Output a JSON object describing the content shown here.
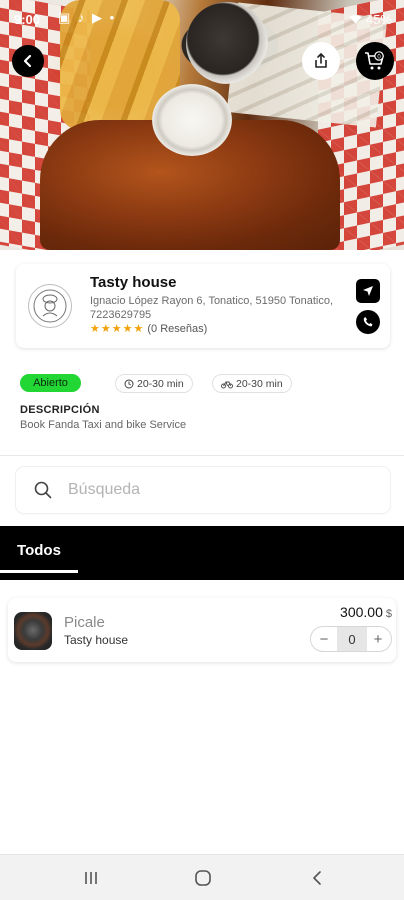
{
  "statusbar": {
    "time": "9:00",
    "icons": "▣ ♪ ▶ •",
    "battery": "45%"
  },
  "hero": {
    "image_desc": "food-photo"
  },
  "restaurant": {
    "name": "Tasty house",
    "address": "Ignacio López Rayon 6, Tonatico, 51950 Tonatico,",
    "phone": "7223629795",
    "stars": "★★★★★",
    "reviews": "(0 Reseñas)"
  },
  "info": {
    "status": "Abierto",
    "delivery_time_1": "20-30 min",
    "delivery_time_2": "20-30 min",
    "description_title": "DESCRIPCIÓN",
    "description_text": "Book Fanda Taxi and bike Service"
  },
  "search": {
    "placeholder": "Búsqueda"
  },
  "tabs": [
    {
      "label": "Todos",
      "active": true
    }
  ],
  "products": [
    {
      "name": "Picale",
      "store": "Tasty house",
      "price": "300.00",
      "currency": "$",
      "quantity": "0",
      "minus": "−",
      "plus": "+"
    }
  ],
  "colors": {
    "accent_black": "#000000",
    "open_green": "#22d634",
    "star_orange": "#f2a20c"
  }
}
